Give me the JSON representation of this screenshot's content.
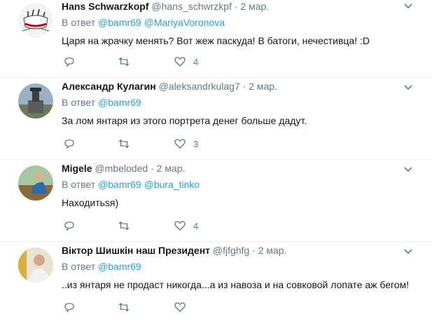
{
  "reply_prefix": "В ответ",
  "tweets": [
    {
      "name": "Hans Schwarzkopf",
      "handle": "@hans_schwrzkpf",
      "time": "2 мар.",
      "mentions": [
        "@bamr69",
        "@MariyaVoronova"
      ],
      "text": "Царя на жрачку менять? Вот жеж паскуда! В батоги, нечестивца! :D",
      "likes": "4"
    },
    {
      "name": "Александр Кулагин",
      "handle": "@aleksandrkulag7",
      "time": "2 мар.",
      "mentions": [
        "@bamr69"
      ],
      "text": "За лом янтаря из этого портрета денег больше дадут.",
      "likes": "3"
    },
    {
      "name": "Migele",
      "handle": "@mbeloded",
      "time": "2 мар.",
      "mentions": [
        "@bamr69",
        "@bura_tinko"
      ],
      "text": "Находитьѕя)",
      "likes": "4"
    },
    {
      "name": "Віктор Шишкін наш Президент",
      "handle": "@fjfghfg",
      "time": "2 мар.",
      "mentions": [
        "@bamr69"
      ],
      "text": "..из янтаря не продаст никогда...а из навоза и на совковой лопате аж бегом!",
      "likes": ""
    }
  ],
  "colors": {
    "link": "#1da1f2",
    "muted": "#657786",
    "text": "#14171a",
    "divider": "#e6ecf0"
  },
  "icons": [
    "reply-icon",
    "retweet-icon",
    "heart-icon",
    "chevron-down-icon"
  ]
}
